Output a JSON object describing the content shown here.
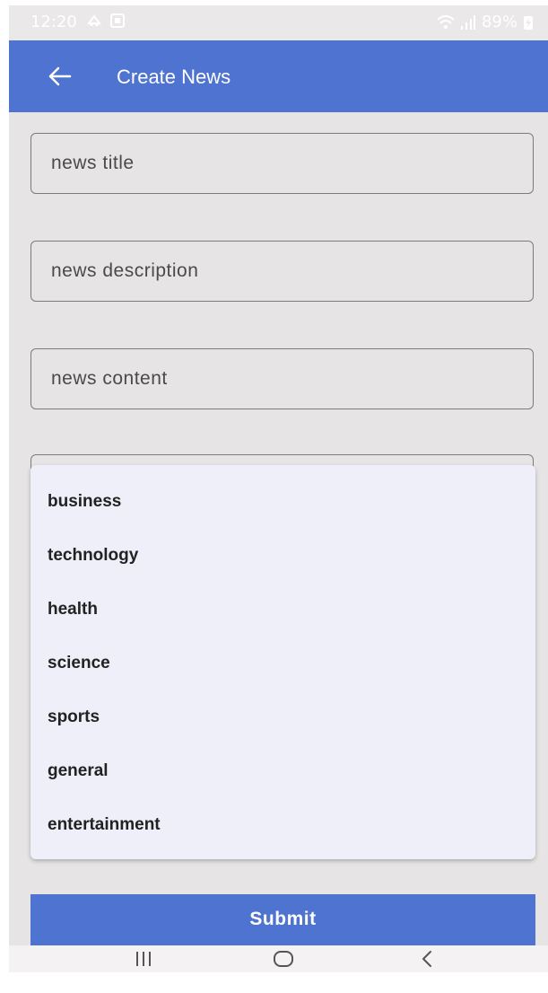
{
  "status_bar": {
    "time": "12:20",
    "battery": "89%",
    "icons_left": [
      "cloud-upload-icon",
      "gallery-icon"
    ],
    "icons_right": [
      "wifi-icon",
      "signal-icon",
      "battery-charging-icon"
    ]
  },
  "app_bar": {
    "title": "Create News",
    "back_icon": "arrow-left-icon"
  },
  "form": {
    "title_placeholder": "news title",
    "description_placeholder": "news description",
    "content_placeholder": "news content"
  },
  "category_dropdown": {
    "options": [
      "business",
      "technology",
      "health",
      "science",
      "sports",
      "general",
      "entertainment"
    ]
  },
  "submit": {
    "label": "Submit"
  },
  "nav_bar": {
    "buttons": [
      "recent-apps-icon",
      "home-icon",
      "back-icon"
    ]
  },
  "colors": {
    "primary": "#4f73d0",
    "background": "#e6e4e4",
    "menu_background": "#eeeff9"
  }
}
